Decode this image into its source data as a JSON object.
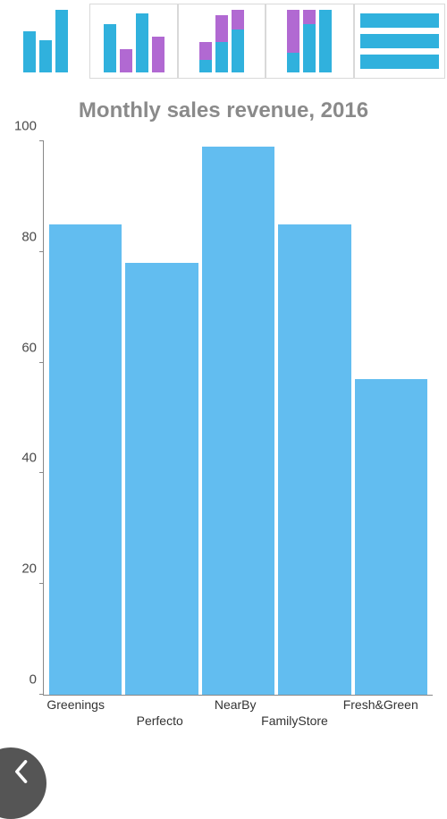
{
  "chart_data": {
    "type": "bar",
    "title": "Monthly sales revenue, 2016",
    "categories": [
      "Greenings",
      "Perfecto",
      "NearBy",
      "FamilyStore",
      "Fresh&Green"
    ],
    "values": [
      85,
      78,
      99,
      85,
      57
    ],
    "xlabel": "",
    "ylabel": "",
    "ylim": [
      0,
      100
    ],
    "y_ticks": [
      0,
      20,
      40,
      60,
      80,
      100
    ]
  },
  "type_selector": {
    "options": [
      {
        "name": "simple-bar",
        "selected": false
      },
      {
        "name": "grouped-bar",
        "selected": true
      },
      {
        "name": "stacked-bar",
        "selected": false
      },
      {
        "name": "stacked-bar-100",
        "selected": false
      },
      {
        "name": "stacked-horiz",
        "selected": false
      }
    ]
  },
  "colors": {
    "bar": "#62bdf0",
    "mini_blue": "#30b1dd",
    "mini_purple": "#b169d2",
    "title": "#8a8a8a"
  },
  "navigation": {
    "back_icon": "chevron-left-icon"
  },
  "x_layout": [
    {
      "index": 0,
      "row": 1,
      "left_pct": 1
    },
    {
      "index": 1,
      "row": 2,
      "left_pct": 24
    },
    {
      "index": 2,
      "row": 1,
      "left_pct": 44
    },
    {
      "index": 3,
      "row": 2,
      "left_pct": 56
    },
    {
      "index": 4,
      "row": 1,
      "left_pct": 77
    }
  ]
}
